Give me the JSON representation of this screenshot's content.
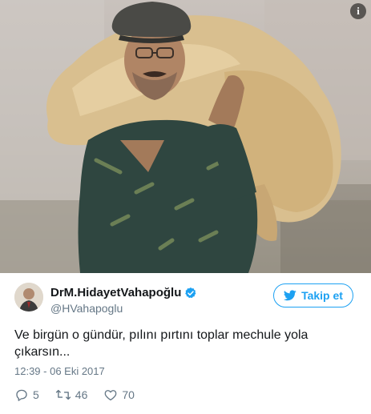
{
  "photo": {
    "info_icon": "info-icon",
    "alt": "edited photo of a man in a flat cap carrying large sacks on his shoulder"
  },
  "user": {
    "display_name": "DrM.HidayetVahapoğlu",
    "handle": "@HVahapoglu",
    "verified": true
  },
  "follow_button": {
    "label": "Takip et",
    "icon": "twitter-bird-icon"
  },
  "tweet": {
    "text": "Ve birgün o gündür, pılını pırtını toplar mechule yola çıkarsın...",
    "timestamp": "12:39 - 06 Eki 2017"
  },
  "actions": {
    "reply_count": "5",
    "retweet_count": "46",
    "like_count": "70"
  },
  "colors": {
    "accent": "#1da1f2",
    "text": "#14171a",
    "muted": "#657786"
  }
}
